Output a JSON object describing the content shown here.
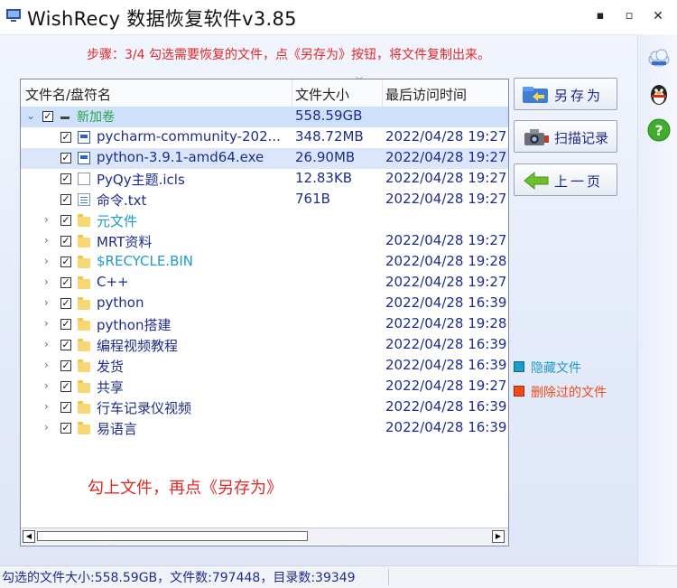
{
  "window": {
    "title": "WishRecy 数据恢复软件v3.85",
    "controls": {
      "minimize": "▪",
      "maximize": "▫",
      "close": "✕"
    }
  },
  "step_text": "步骤：3/4 勾选需要恢复的文件，点《另存为》按钮，将文件复制出来。",
  "columns": {
    "name": "文件名/盘符名",
    "size": "文件大小",
    "time": "最后访问时间"
  },
  "rows": [
    {
      "name": "新加卷",
      "size": "558.59GB",
      "time": "",
      "icon": "volume-icon",
      "checked": true,
      "color": "green"
    },
    {
      "name": "pycharm-community-202...",
      "size": "348.72MB",
      "time": "2022/04/28 19:27:",
      "icon": "exe-icon",
      "checked": true
    },
    {
      "name": "python-3.9.1-amd64.exe",
      "size": "26.90MB",
      "time": "2022/04/28 19:27:",
      "icon": "exe-icon",
      "checked": true
    },
    {
      "name": "PyQy主题.icls",
      "size": "12.83KB",
      "time": "2022/04/28 19:27:",
      "icon": "file-icon",
      "checked": true
    },
    {
      "name": "命令.txt",
      "size": "761B",
      "time": "2022/04/28 19:27:",
      "icon": "text-file-icon",
      "checked": true
    },
    {
      "name": "元文件",
      "size": "",
      "time": "",
      "icon": "folder-icon",
      "checked": true,
      "color": "teal"
    },
    {
      "name": "MRT资料",
      "size": "",
      "time": "2022/04/28 19:27:",
      "icon": "folder-icon",
      "checked": true
    },
    {
      "name": "$RECYCLE.BIN",
      "size": "",
      "time": "2022/04/28 19:28:",
      "icon": "folder-icon",
      "checked": true,
      "color": "teal"
    },
    {
      "name": "C++",
      "size": "",
      "time": "2022/04/28 19:27:",
      "icon": "folder-icon",
      "checked": true
    },
    {
      "name": "python",
      "size": "",
      "time": "2022/04/28 16:39:",
      "icon": "folder-icon",
      "checked": true
    },
    {
      "name": "python搭建",
      "size": "",
      "time": "2022/04/28 19:28:",
      "icon": "folder-icon",
      "checked": true
    },
    {
      "name": "编程视频教程",
      "size": "",
      "time": "2022/04/28 16:39:",
      "icon": "folder-icon",
      "checked": true
    },
    {
      "name": "发货",
      "size": "",
      "time": "2022/04/28 16:39:",
      "icon": "folder-icon",
      "checked": true
    },
    {
      "name": "共享",
      "size": "",
      "time": "2022/04/28 19:27:",
      "icon": "folder-icon",
      "checked": true
    },
    {
      "name": "行车记录仪视频",
      "size": "",
      "time": "2022/04/28 16:39:",
      "icon": "folder-icon",
      "checked": true
    },
    {
      "name": "易语言",
      "size": "",
      "time": "2022/04/28 16:39:",
      "icon": "folder-icon",
      "checked": true
    }
  ],
  "hint": "勾上文件，再点《另存为》",
  "buttons": {
    "save_as": "另存为",
    "scan_records": "扫描记录",
    "prev_page": "上一页"
  },
  "legend": {
    "hidden_files": "隐藏文件",
    "hidden_color": "#1e9bc6",
    "deleted_files": "删除过的文件",
    "deleted_color": "#f04a1a"
  },
  "scrollbar": {
    "left_arrow": "◀",
    "right_arrow": "▶"
  },
  "status": "勾选的文件大小:558.59GB，文件数:797448，目录数:39349"
}
